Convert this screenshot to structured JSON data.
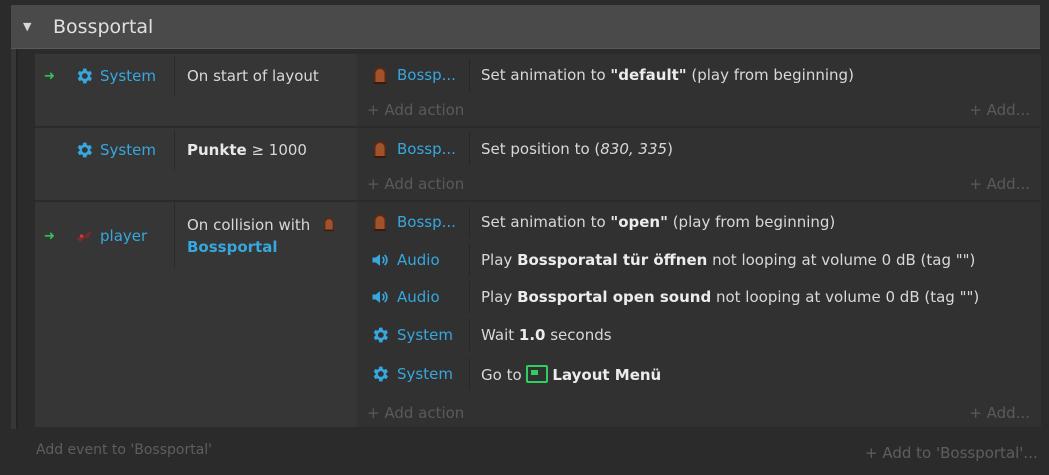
{
  "group": {
    "title": "Bossportal"
  },
  "add": {
    "action": "+ Add action",
    "right": "+ Add...",
    "event": "Add event to 'Bossportal'",
    "to_group": "+ Add to 'Bossportal'..."
  },
  "events": [
    {
      "condition": {
        "object": "System",
        "text": "On start of layout"
      },
      "actions": [
        {
          "object": "Bossp...",
          "text_pre": "Set animation to ",
          "bold": "\"default\"",
          "text_post": " (play from beginning)"
        }
      ]
    },
    {
      "condition": {
        "object": "System",
        "bold": "Punkte",
        "text": " ≥ 1000"
      },
      "actions": [
        {
          "object": "Bossp...",
          "text_pre": "Set position to (",
          "italic": "830, 335",
          "text_post": ")"
        }
      ]
    },
    {
      "condition": {
        "object": "player",
        "text": "On collision with",
        "link": "Bossportal"
      },
      "actions": [
        {
          "object": "Bossp...",
          "text_pre": "Set animation to ",
          "bold": "\"open\"",
          "text_post": " (play from beginning)"
        },
        {
          "object": "Audio",
          "text_pre": "Play ",
          "bold": "Bossporatal tür öffnen",
          "text_post": " not looping at volume 0 dB (tag \"\")"
        },
        {
          "object": "Audio",
          "text_pre": "Play ",
          "bold": "Bossportal open sound",
          "text_post": " not looping at volume 0 dB (tag \"\")"
        },
        {
          "object": "System",
          "text_pre": "Wait ",
          "bold": "1.0",
          "text_post": " seconds"
        },
        {
          "object": "System",
          "text_pre": "Go to ",
          "bold": "Layout Menü",
          "text_post": ""
        }
      ]
    }
  ],
  "icons": {
    "trigger": "arrow-right-icon",
    "system": "gear-icon",
    "sprite": "door-sprite-icon",
    "audio": "speaker-icon",
    "layout": "layout-icon",
    "player": "player-sprite-icon"
  },
  "colors": {
    "link": "#36a7df",
    "trigger": "#2ec45a",
    "layout": "#2fcf5e"
  }
}
